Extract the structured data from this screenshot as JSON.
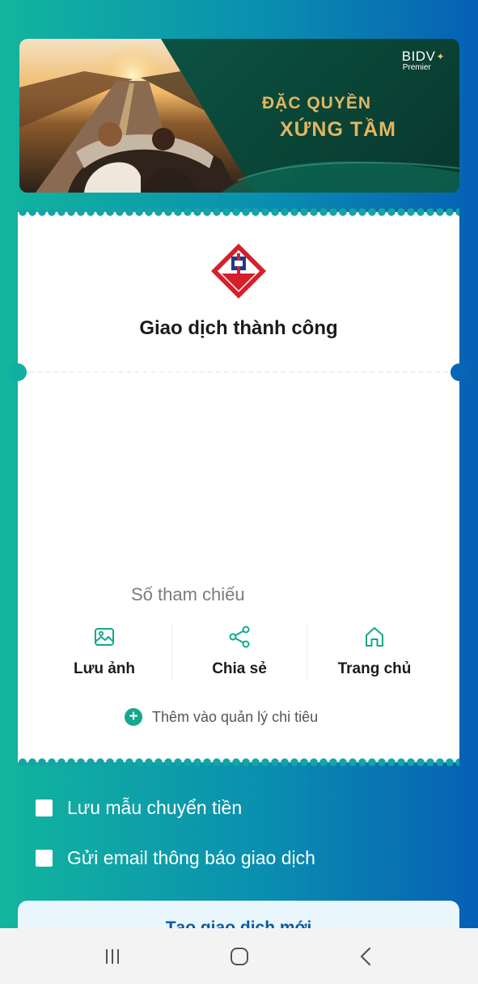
{
  "banner": {
    "brand": "BIDV",
    "tier": "Premier",
    "slogan_line1": "ĐẶC QUYỀN",
    "slogan_line2": "XỨNG TẦM"
  },
  "receipt": {
    "status_title": "Giao dịch thành công",
    "reference_label": "Số tham chiếu",
    "actions": [
      {
        "label": "Lưu ảnh",
        "icon": "image-icon"
      },
      {
        "label": "Chia sẻ",
        "icon": "share-icon"
      },
      {
        "label": "Trang chủ",
        "icon": "home-icon"
      }
    ],
    "add_expense_label": "Thêm vào quản lý chi tiêu"
  },
  "options": {
    "save_template": "Lưu mẫu chuyển tiền",
    "send_email": "Gửi email thông báo giao dịch"
  },
  "new_transaction_label": "Tạo giao dịch mới",
  "colors": {
    "accent_teal": "#14a88f",
    "brand_red": "#d4202a",
    "brand_blue": "#1c3a8f",
    "gold": "#e2b660"
  }
}
